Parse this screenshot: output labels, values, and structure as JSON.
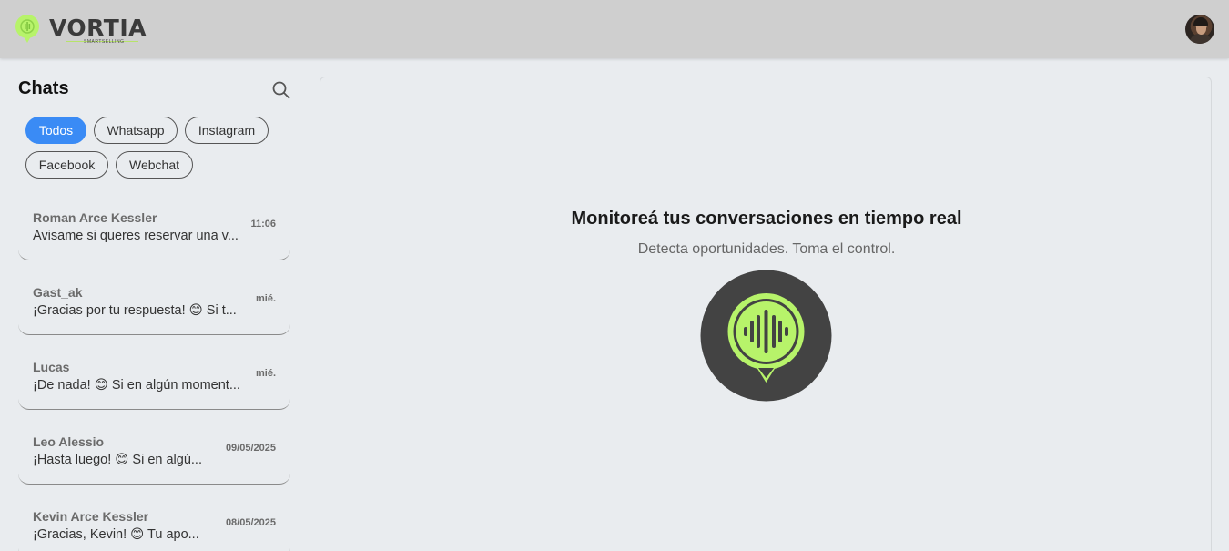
{
  "brand": {
    "name": "VORTIA",
    "tagline": "SMARTSELLING",
    "accent_color": "#b7f36a",
    "dark_color": "#434343"
  },
  "header": {
    "avatar_icon": "user-avatar"
  },
  "sidebar": {
    "title": "Chats",
    "search_icon": "search-icon",
    "filters": [
      {
        "label": "Todos",
        "active": true
      },
      {
        "label": "Whatsapp",
        "active": false
      },
      {
        "label": "Instagram",
        "active": false
      },
      {
        "label": "Facebook",
        "active": false
      },
      {
        "label": "Webchat",
        "active": false
      }
    ],
    "chats": [
      {
        "name": "Roman Arce Kessler",
        "preview": "Avisame si queres reservar una v...",
        "time": "11:06"
      },
      {
        "name": "Gast_ak",
        "preview": "¡Gracias por tu respuesta! 😊 Si t...",
        "time": "mié."
      },
      {
        "name": "Lucas",
        "preview": "¡De nada! 😊 Si en algún moment...",
        "time": "mié."
      },
      {
        "name": "Leo Alessio",
        "preview": "¡Hasta luego! 😊 Si en algú...",
        "time": "09/05/2025"
      },
      {
        "name": "Kevin Arce Kessler",
        "preview": "¡Gracias, Kevin! 😊 Tu apo...",
        "time": "08/05/2025"
      }
    ]
  },
  "main": {
    "title": "Monitoreá tus conversaciones en tiempo real",
    "subtitle": "Detecta oportunidades. Toma el control.",
    "hero_icon": "voice-bubble-icon"
  },
  "colors": {
    "active_chip": "#3a8bf5",
    "topbar": "#cfcfcf",
    "background": "#e9ecef"
  }
}
